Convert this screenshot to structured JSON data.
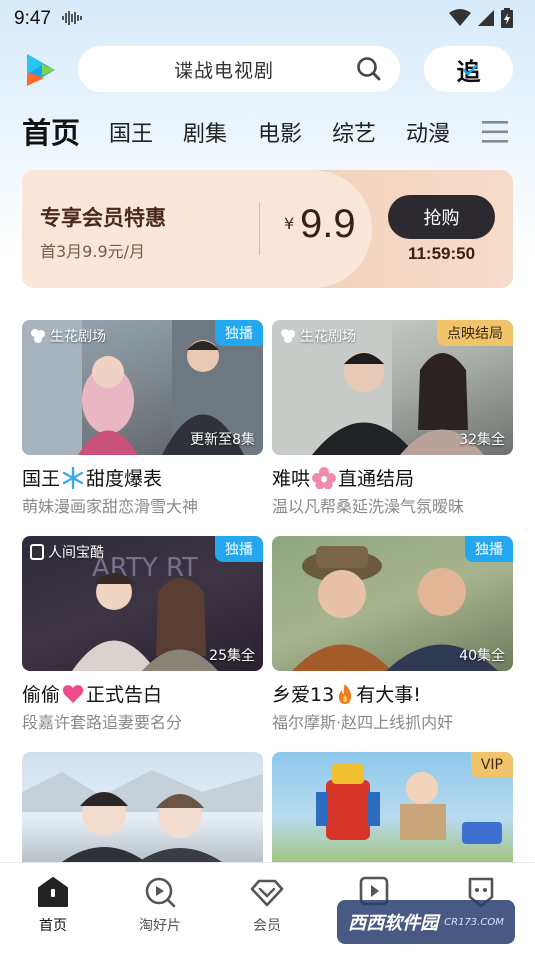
{
  "status_bar": {
    "time": "9:47"
  },
  "search": {
    "query": "谍战电视剧"
  },
  "follow_button": {
    "label": "追"
  },
  "tabs": [
    {
      "label": "首页",
      "active": true
    },
    {
      "label": "国王",
      "active": false
    },
    {
      "label": "剧集",
      "active": false
    },
    {
      "label": "电影",
      "active": false
    },
    {
      "label": "综艺",
      "active": false
    },
    {
      "label": "动漫",
      "active": false
    }
  ],
  "vip_banner": {
    "title": "专享会员特惠",
    "subtitle": "首3月9.9元/月",
    "currency": "¥",
    "price": "9.9",
    "button": "抢购",
    "countdown": "11:59:50"
  },
  "cards": [
    {
      "studio": "生花剧场",
      "badge": "独播",
      "badge_color": "#23a8ef",
      "episodes": "更新至8集",
      "title_a": "国王",
      "title_b": "甜度爆表",
      "title_icon": "snowflake-icon",
      "subtitle": "萌妹漫画家甜恋滑雪大神"
    },
    {
      "studio": "生花剧场",
      "badge": "点映结局",
      "badge_color": "#f1c36a",
      "episodes": "32集全",
      "title_a": "难哄",
      "title_b": "直通结局",
      "title_icon": "flower-icon",
      "subtitle": "温以凡帮桑延洗澡气氛暧昧"
    },
    {
      "studio": "人间宝酷",
      "badge": "独播",
      "badge_color": "#23a8ef",
      "episodes": "25集全",
      "title_a": "偷偷",
      "title_b": "正式告白",
      "title_icon": "heart-icon",
      "subtitle": "段嘉许套路追妻要名分"
    },
    {
      "studio": "",
      "badge": "独播",
      "badge_color": "#23a8ef",
      "episodes": "40集全",
      "title_a": "乡爱13",
      "title_b": "有大事!",
      "title_icon": "fire-icon",
      "subtitle": "福尔摩斯·赵四上线抓内奸"
    },
    {
      "studio": "",
      "badge": "",
      "badge_color": "",
      "episodes": "",
      "title_a": "",
      "title_b": "",
      "title_icon": "",
      "subtitle": ""
    },
    {
      "studio": "",
      "badge": "VIP",
      "badge_color": "#f1c36a",
      "episodes": "",
      "title_a": "",
      "title_b": "",
      "title_icon": "",
      "subtitle": ""
    }
  ],
  "bottom_nav": [
    {
      "label": "首页",
      "icon": "home-icon",
      "active": true
    },
    {
      "label": "淘好片",
      "icon": "discover-icon",
      "active": false
    },
    {
      "label": "会员",
      "icon": "vip-diamond-icon",
      "active": false
    },
    {
      "label": "",
      "icon": "shorts-play-icon",
      "active": false
    },
    {
      "label": "",
      "icon": "profile-icon",
      "active": false
    }
  ],
  "watermark": {
    "text": "西西软件园",
    "url": "CR173.COM"
  },
  "colors": {
    "accent_blue": "#23a8ef",
    "vip_gold": "#f1c36a",
    "vip_bg": "#f7d6c0"
  }
}
